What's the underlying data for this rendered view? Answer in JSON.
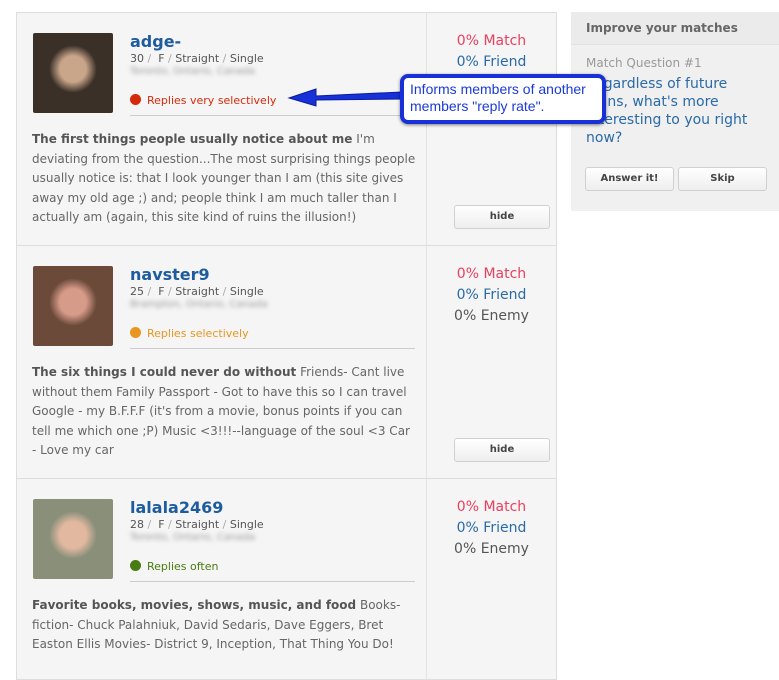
{
  "profiles": [
    {
      "name": "adge-",
      "age": "30",
      "gender": "F",
      "orientation": "Straight",
      "status": "Single",
      "location": "Toronto, Ontario, Canada",
      "reply": "Replies very selectively",
      "reply_color": "#d42a0a",
      "essay_title": "The first things people usually notice about me",
      "essay": "I'm deviating from the question...The most surprising things people usually notice is: that I look younger than I am (this site gives away my old age ;) and; people think I am much taller than I actually am (again, this site kind of ruins the illusion!)",
      "match": "0% Match",
      "friend": "0% Friend",
      "enemy": "",
      "hide": "hide"
    },
    {
      "name": "navster9",
      "age": "25",
      "gender": "F",
      "orientation": "Straight",
      "status": "Single",
      "location": "Brampton, Ontario, Canada",
      "reply": "Replies selectively",
      "reply_color": "#e8961e",
      "essay_title": "The six things I could never do without",
      "essay": "Friends- Cant live without them Family Passport - Got to have this so I can travel Google - my B.F.F.F (it's from a movie, bonus points if you can tell me which one ;P) Music <3!!!--language of the soul <3 Car - Love my car",
      "match": "0% Match",
      "friend": "0% Friend",
      "enemy": "0% Enemy",
      "hide": "hide"
    },
    {
      "name": "lalala2469",
      "age": "28",
      "gender": "F",
      "orientation": "Straight",
      "status": "Single",
      "location": "Toronto, Ontario, Canada",
      "reply": "Replies often",
      "reply_color": "#4a7a12",
      "essay_title": "Favorite books, movies, shows, music, and food",
      "essay": "Books- fiction- Chuck Palahniuk, David Sedaris, Dave Eggers, Bret Easton Ellis Movies- District 9, Inception, That Thing You Do!",
      "match": "0% Match",
      "friend": "0% Friend",
      "enemy": "0% Enemy",
      "hide": ""
    }
  ],
  "sidebar": {
    "title": "Improve your matches",
    "question_label": "Match Question #1",
    "question": "Regardless of future plans, what's more interesting to you right now?",
    "answer": "Answer it!",
    "skip": "Skip"
  },
  "callout": {
    "text": "Informs members of another members \"reply rate\".",
    "color": "#1730d8"
  }
}
